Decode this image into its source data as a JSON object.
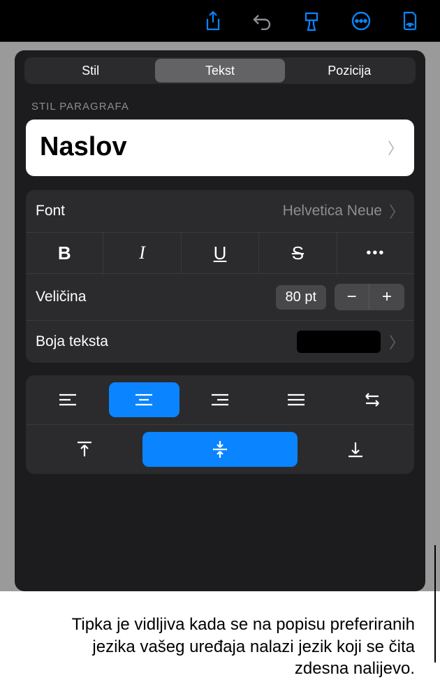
{
  "toolbar": {
    "icons": [
      "share-icon",
      "undo-icon",
      "format-brush-icon",
      "more-icon",
      "document-view-icon"
    ]
  },
  "tabs": {
    "items": [
      "Stil",
      "Tekst",
      "Pozicija"
    ],
    "active": 1
  },
  "section": {
    "paragraph_style_label": "STIL PARAGRAFA"
  },
  "paragraph_style": {
    "value": "Naslov"
  },
  "font": {
    "label": "Font",
    "value": "Helvetica Neue"
  },
  "styles": {
    "bold": "B",
    "italic": "I",
    "underline": "U",
    "strike": "S",
    "more": "•••"
  },
  "size": {
    "label": "Veličina",
    "value": "80 pt",
    "minus": "−",
    "plus": "+"
  },
  "text_color": {
    "label": "Boja teksta",
    "value": "#000000"
  },
  "alignment": {
    "horizontal_active": 1,
    "vertical_active": 1
  },
  "caption": "Tipka je vidljiva kada se na popisu preferiranih jezika vašeg uređaja nalazi jezik koji se čita zdesna nalijevo."
}
